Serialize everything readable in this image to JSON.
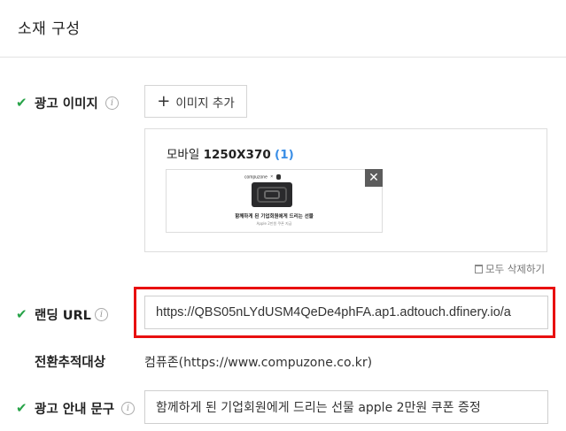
{
  "section": {
    "title": "소재 구성"
  },
  "ad_image": {
    "label": "광고 이미지",
    "info_icon": "info-icon",
    "add_button_icon": "+",
    "add_button_label": "이미지 추가",
    "panel": {
      "title_prefix": "모바일",
      "size": "1250X370",
      "count": "(1)",
      "close_glyph": "✕",
      "thumbnail": {
        "brand_text": "compuzone",
        "x_text": "×",
        "main_text": "함께하게 된 기업회원에게 드리는 선물",
        "sub_text": "Apple 2만원 쿠폰 지급"
      }
    },
    "delete_all_label": "모두 삭제하기"
  },
  "landing_url": {
    "label": "랜딩 URL",
    "value": "https://QBS05nLYdUSM4QeDe4phFA.ap1.adtouch.dfinery.io/a"
  },
  "conversion_target": {
    "label": "전환추적대상",
    "value": "컴퓨존(https://www.compuzone.co.kr)"
  },
  "ad_guide_text": {
    "label": "광고 안내 문구",
    "value": "함께하게 된 기업회원에게 드리는 선물 apple 2만원 쿠폰 증정"
  },
  "colors": {
    "check": "#27a348",
    "highlight_box": "#e81010",
    "count": "#3a8ee6"
  }
}
